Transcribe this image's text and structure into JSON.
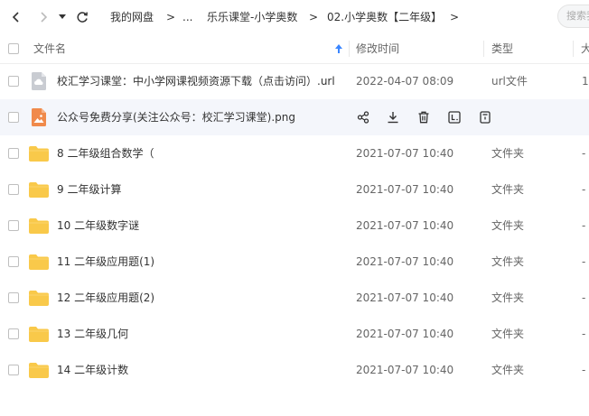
{
  "toolbar": {
    "breadcrumb": [
      {
        "label": "我的网盘"
      },
      {
        "label": "..."
      },
      {
        "label": "乐乐课堂-小学奥数"
      },
      {
        "label": "02.小学奥数【二年级】"
      }
    ],
    "separator": ">",
    "search_placeholder": "搜索我的"
  },
  "columns": {
    "name": "文件名",
    "modified": "修改时间",
    "type": "类型",
    "size": "大"
  },
  "files": [
    {
      "name": "校汇学习课堂：中小学网课视频资源下载（点击访问）.url",
      "modified": "2022-04-07 08:09",
      "type": "url文件",
      "size": "1",
      "icon": "url-file-icon"
    },
    {
      "name": "公众号免费分享(关注公众号：校汇学习课堂).png",
      "modified": "",
      "type": "",
      "size": "",
      "icon": "image-file-icon"
    },
    {
      "name": "8 二年级组合数学（",
      "modified": "2021-07-07 10:40",
      "type": "文件夹",
      "size": "-",
      "icon": "folder-icon"
    },
    {
      "name": "9 二年级计算",
      "modified": "2021-07-07 10:40",
      "type": "文件夹",
      "size": "-",
      "icon": "folder-icon"
    },
    {
      "name": "10 二年级数字谜",
      "modified": "2021-07-07 10:40",
      "type": "文件夹",
      "size": "-",
      "icon": "folder-icon"
    },
    {
      "name": "11 二年级应用题(1)",
      "modified": "2021-07-07 10:40",
      "type": "文件夹",
      "size": "-",
      "icon": "folder-icon"
    },
    {
      "name": "12 二年级应用题(2)",
      "modified": "2021-07-07 10:40",
      "type": "文件夹",
      "size": "-",
      "icon": "folder-icon"
    },
    {
      "name": "13 二年级几何",
      "modified": "2021-07-07 10:40",
      "type": "文件夹",
      "size": "-",
      "icon": "folder-icon"
    },
    {
      "name": "14 二年级计数",
      "modified": "2021-07-07 10:40",
      "type": "文件夹",
      "size": "-",
      "icon": "folder-icon"
    }
  ],
  "row_actions": [
    "share-icon",
    "download-icon",
    "delete-icon",
    "rename-icon",
    "more-icon"
  ],
  "colors": {
    "folder": "#f9c94a",
    "image_file": "#f08a4b",
    "url_file": "#c9ccd2",
    "hover_row": "#f4f6fb",
    "sort_arrow": "#3a86ff"
  }
}
